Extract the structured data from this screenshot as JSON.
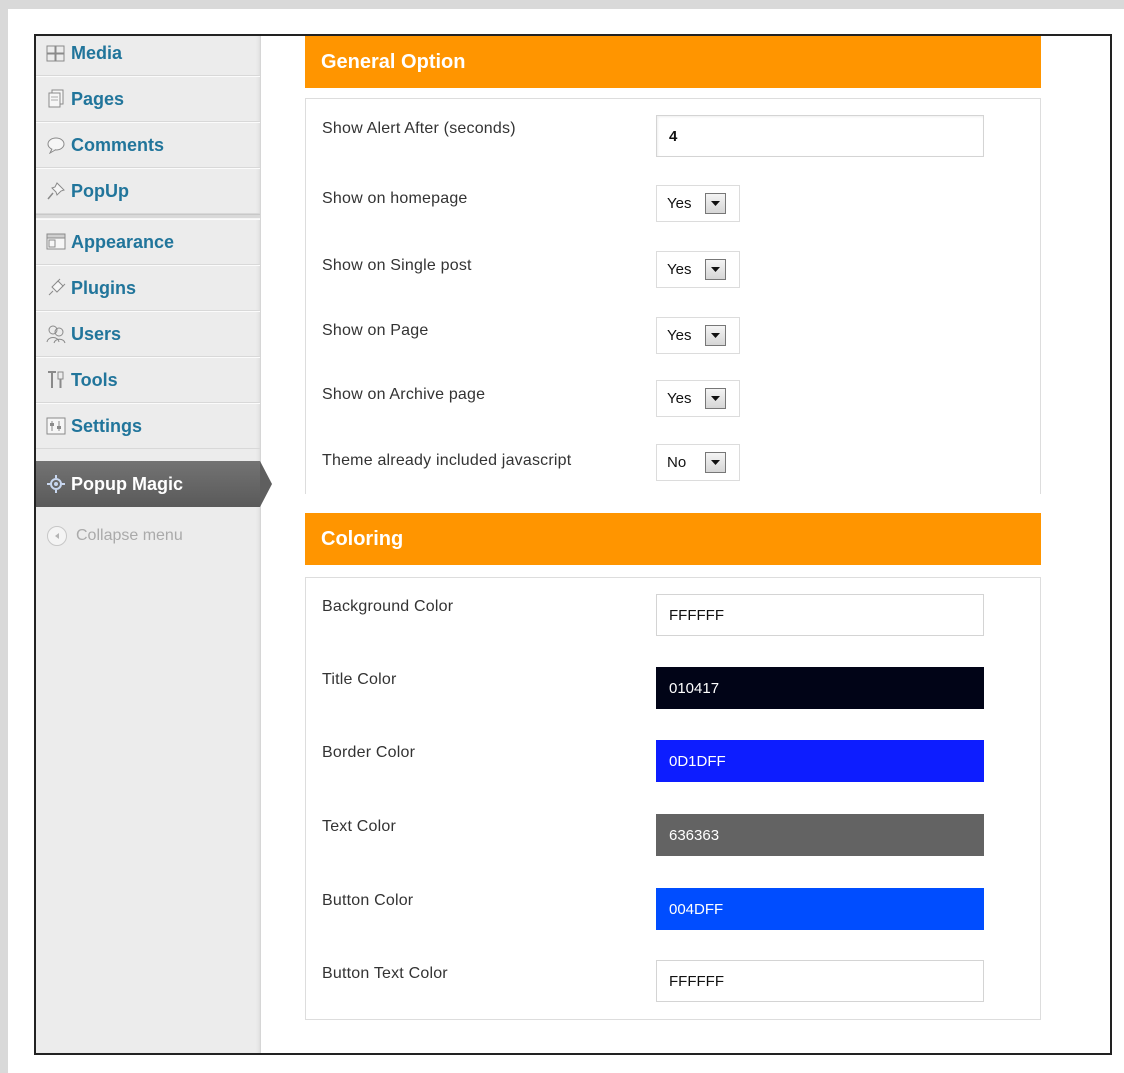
{
  "sidebar": {
    "items": [
      {
        "label": "Media",
        "icon": "media-icon"
      },
      {
        "label": "Pages",
        "icon": "pages-icon"
      },
      {
        "label": "Comments",
        "icon": "comments-icon"
      },
      {
        "label": "PopUp",
        "icon": "pushpin-icon"
      },
      {
        "label": "Appearance",
        "icon": "appearance-icon"
      },
      {
        "label": "Plugins",
        "icon": "plugins-icon"
      },
      {
        "label": "Users",
        "icon": "users-icon"
      },
      {
        "label": "Tools",
        "icon": "tools-icon"
      },
      {
        "label": "Settings",
        "icon": "settings-icon"
      }
    ],
    "active_item": {
      "label": "Popup Magic",
      "icon": "gear-icon"
    },
    "collapse_label": "Collapse menu"
  },
  "general": {
    "title": "General Option",
    "alert_label": "Show Alert After (seconds)",
    "alert_value": "4",
    "homepage_label": "Show on homepage",
    "homepage_value": "Yes",
    "single_label": "Show on Single post",
    "single_value": "Yes",
    "page_label": "Show on Page",
    "page_value": "Yes",
    "archive_label": "Show on Archive page",
    "archive_value": "Yes",
    "theme_js_label": "Theme already included javascript",
    "theme_js_value": "No"
  },
  "coloring": {
    "title": "Coloring",
    "bg_label": "Background Color",
    "bg_value": "FFFFFF",
    "title_color_label": "Title Color",
    "title_color_value": "010417",
    "border_label": "Border Color",
    "border_value": "0D1DFF",
    "text_label": "Text Color",
    "text_value": "636363",
    "button_label": "Button Color",
    "button_value": "004DFF",
    "button_text_label": "Button Text Color",
    "button_text_value": "FFFFFF"
  },
  "colors": {
    "accent": "#ff9500",
    "link": "#21759b",
    "bg_swatch": "#FFFFFF",
    "title_swatch": "#010417",
    "border_swatch": "#0D1DFF",
    "text_swatch": "#636363",
    "button_swatch": "#004DFF",
    "button_text_swatch": "#FFFFFF"
  }
}
